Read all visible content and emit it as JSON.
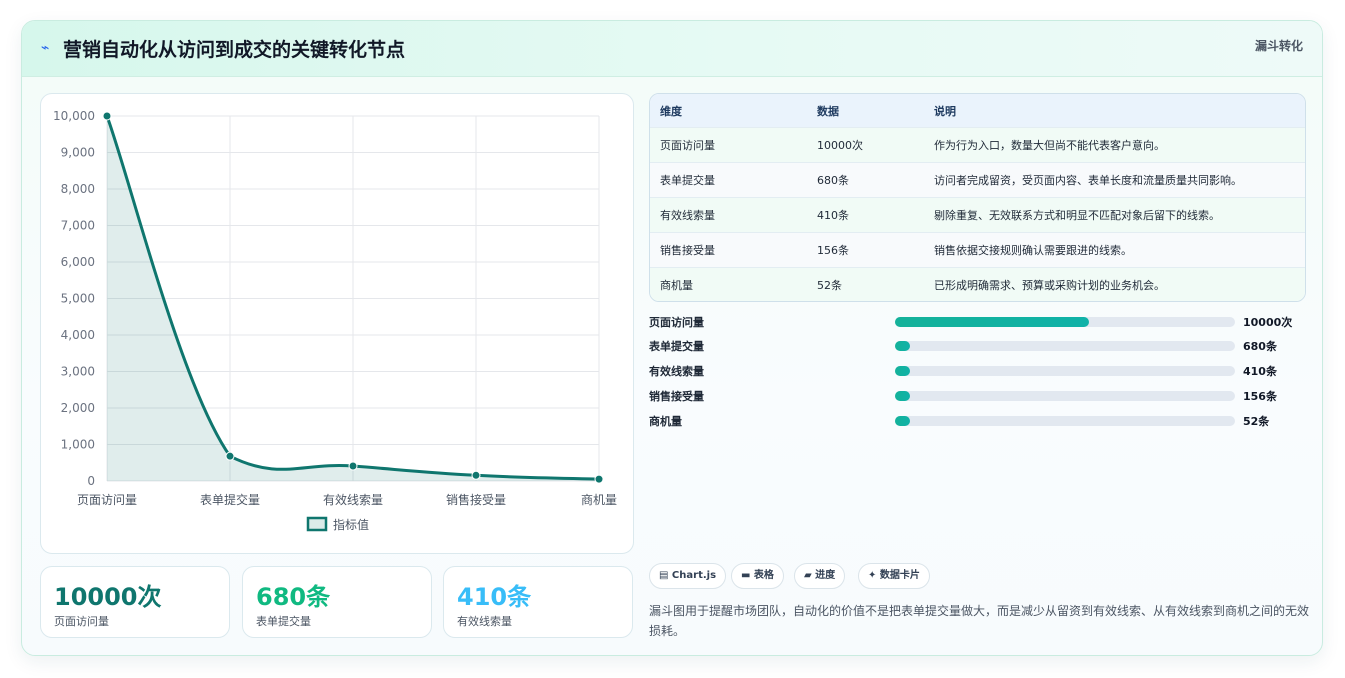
{
  "header": {
    "icon": "pulse-icon",
    "title": "营销自动化从访问到成交的关键转化节点",
    "tag": "漏斗转化"
  },
  "chart_data": {
    "type": "line",
    "categories": [
      "页面访问量",
      "表单提交量",
      "有效线索量",
      "销售接受量",
      "商机量"
    ],
    "series": [
      {
        "name": "指标值",
        "values": [
          10000,
          680,
          410,
          156,
          52
        ]
      }
    ],
    "ylim": [
      0,
      10000
    ],
    "yticks": [
      "0",
      "1,000",
      "2,000",
      "3,000",
      "4,000",
      "5,000",
      "6,000",
      "7,000",
      "8,000",
      "9,000",
      "10,000"
    ],
    "legend_position": "bottom",
    "grid": true,
    "color": "#0f766e"
  },
  "stats": [
    {
      "value": "10000次",
      "label": "页面访问量",
      "color": "#0f766e"
    },
    {
      "value": "680条",
      "label": "表单提交量",
      "color": "#10b981"
    },
    {
      "value": "410条",
      "label": "有效线索量",
      "color": "#38bdf8"
    }
  ],
  "table": {
    "headers": [
      "维度",
      "数据",
      "说明"
    ],
    "rows": [
      [
        "页面访问量",
        "10000次",
        "作为行为入口，数量大但尚不能代表客户意向。"
      ],
      [
        "表单提交量",
        "680条",
        "访问者完成留资，受页面内容、表单长度和流量质量共同影响。"
      ],
      [
        "有效线索量",
        "410条",
        "剔除重复、无效联系方式和明显不匹配对象后留下的线索。"
      ],
      [
        "销售接受量",
        "156条",
        "销售依据交接规则确认需要跟进的线索。"
      ],
      [
        "商机量",
        "52条",
        "已形成明确需求、预算或采购计划的业务机会。"
      ]
    ]
  },
  "progress": [
    {
      "label": "页面访问量",
      "value": "10000次",
      "fraction": 0.57
    },
    {
      "label": "表单提交量",
      "value": "680条",
      "fraction": 0.045
    },
    {
      "label": "有效线索量",
      "value": "410条",
      "fraction": 0.045
    },
    {
      "label": "销售接受量",
      "value": "156条",
      "fraction": 0.045
    },
    {
      "label": "商机量",
      "value": "52条",
      "fraction": 0.045
    }
  ],
  "chips": [
    {
      "icon": "chart-icon",
      "label": "▤ Chart.js"
    },
    {
      "icon": "table-icon",
      "label": "▬ 表格"
    },
    {
      "icon": "progress-icon",
      "label": "▰ 进度"
    },
    {
      "icon": "sparkle-icon",
      "label": "✦ 数据卡片"
    }
  ],
  "note": "漏斗图用于提醒市场团队，自动化的价值不是把表单提交量做大，而是减少从留资到有效线索、从有效线索到商机之间的无效损耗。"
}
